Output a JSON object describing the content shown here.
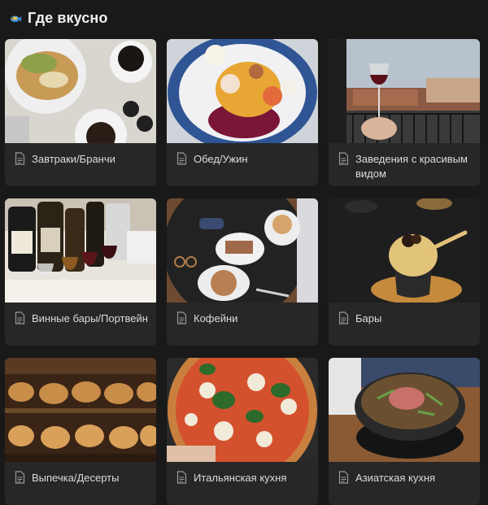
{
  "page": {
    "title": "Где вкусно",
    "icon": "fish-emoji-icon"
  },
  "cards": [
    {
      "id": "breakfast",
      "title": "Завтраки/Бранчи",
      "icon": "page-icon"
    },
    {
      "id": "lunch",
      "title": "Обед/Ужин",
      "icon": "page-icon"
    },
    {
      "id": "views",
      "title": "Заведения с красивым видом",
      "icon": "page-icon"
    },
    {
      "id": "wine",
      "title": "Винные бары/Портвейн",
      "icon": "page-icon"
    },
    {
      "id": "coffee",
      "title": "Кофейни",
      "icon": "page-icon"
    },
    {
      "id": "bars",
      "title": "Бары",
      "icon": "page-icon"
    },
    {
      "id": "bakery",
      "title": "Выпечка/Десерты",
      "icon": "page-icon"
    },
    {
      "id": "italian",
      "title": "Итальянская кухня",
      "icon": "page-icon"
    },
    {
      "id": "asian",
      "title": "Азиатская кухня",
      "icon": "page-icon"
    }
  ],
  "colors": {
    "background": "#191919",
    "card": "#272727",
    "text": "#dcdcdc"
  }
}
